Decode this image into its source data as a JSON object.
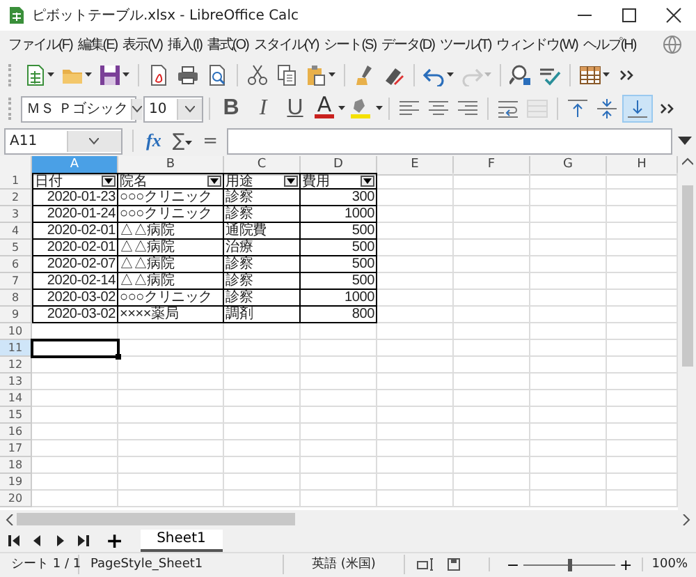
{
  "window": {
    "title": "ピボットテーブル.xlsx - LibreOffice Calc"
  },
  "menu": [
    "ファイル(F)",
    "編集(E)",
    "表示(V)",
    "挿入(I)",
    "書式(O)",
    "スタイル(Y)",
    "シート(S)",
    "データ(D)",
    "ツール(T)",
    "ウィンドウ(W)",
    "ヘルプ(H)"
  ],
  "standard_toolbar": [
    {
      "kind": "new",
      "dropdown": true,
      "disabled": false
    },
    {
      "kind": "open",
      "dropdown": true,
      "disabled": false
    },
    {
      "kind": "save",
      "dropdown": true,
      "disabled": false
    },
    {
      "kind": "separator"
    },
    {
      "kind": "pdf",
      "dropdown": false,
      "disabled": false
    },
    {
      "kind": "print",
      "dropdown": false,
      "disabled": false
    },
    {
      "kind": "preview",
      "dropdown": false,
      "disabled": false
    },
    {
      "kind": "separator"
    },
    {
      "kind": "cut",
      "dropdown": false,
      "disabled": false
    },
    {
      "kind": "copy",
      "dropdown": false,
      "disabled": false
    },
    {
      "kind": "paste",
      "dropdown": true,
      "disabled": false
    },
    {
      "kind": "separator"
    },
    {
      "kind": "brush",
      "dropdown": false,
      "disabled": false
    },
    {
      "kind": "clear",
      "dropdown": false,
      "disabled": false
    },
    {
      "kind": "separator"
    },
    {
      "kind": "undo",
      "dropdown": true,
      "disabled": false
    },
    {
      "kind": "redo",
      "dropdown": true,
      "disabled": true
    },
    {
      "kind": "separator"
    },
    {
      "kind": "find",
      "dropdown": false,
      "disabled": false
    },
    {
      "kind": "spell",
      "dropdown": false,
      "disabled": false
    },
    {
      "kind": "separator"
    },
    {
      "kind": "rows",
      "dropdown": true,
      "disabled": false
    },
    {
      "kind": "more",
      "dropdown": false,
      "disabled": false
    }
  ],
  "format_toolbar": {
    "font_name": "ＭＳ Ｐゴシック",
    "font_size": "10",
    "buttons": [
      {
        "kind": "bold",
        "label": "B",
        "selected": false,
        "disabled": false
      },
      {
        "kind": "italic",
        "label": "I",
        "selected": false,
        "disabled": false
      },
      {
        "kind": "underline",
        "label": "U",
        "selected": false,
        "disabled": false
      },
      {
        "kind": "font-color",
        "label": "A",
        "selected": false,
        "disabled": false
      },
      {
        "kind": "highlight",
        "selected": false,
        "disabled": false
      },
      {
        "kind": "separator"
      },
      {
        "kind": "align-left",
        "selected": false,
        "disabled": false
      },
      {
        "kind": "align-center",
        "selected": false,
        "disabled": false
      },
      {
        "kind": "align-right",
        "selected": false,
        "disabled": false
      },
      {
        "kind": "separator"
      },
      {
        "kind": "wrap",
        "selected": false,
        "disabled": false
      },
      {
        "kind": "merge",
        "selected": false,
        "disabled": true
      },
      {
        "kind": "separator"
      },
      {
        "kind": "valign-top",
        "selected": false,
        "disabled": false
      },
      {
        "kind": "valign-center",
        "selected": false,
        "disabled": false
      },
      {
        "kind": "valign-bottom",
        "selected": true,
        "disabled": false
      },
      {
        "kind": "more",
        "selected": false,
        "disabled": false
      }
    ]
  },
  "formula_bar": {
    "name_box": "A11",
    "function_wizard": "fx",
    "sum": "∑",
    "equals": "="
  },
  "columns": [
    {
      "letter": "A",
      "selected": true
    },
    {
      "letter": "B",
      "selected": false
    },
    {
      "letter": "C",
      "selected": false
    },
    {
      "letter": "D",
      "selected": false
    },
    {
      "letter": "E",
      "selected": false
    },
    {
      "letter": "F",
      "selected": false
    },
    {
      "letter": "G",
      "selected": false
    },
    {
      "letter": "H",
      "selected": false
    }
  ],
  "header_row": {
    "number": "1",
    "selected": false,
    "fields": [
      {
        "label": "日付",
        "kind": "number"
      },
      {
        "label": "院名",
        "kind": "text"
      },
      {
        "label": "用途",
        "kind": "text"
      },
      {
        "label": "費用",
        "kind": "number"
      }
    ]
  },
  "rows": [
    {
      "number": "2",
      "selected": false,
      "cells": [
        "2020-01-23",
        "○○○クリニック",
        "診察",
        "300"
      ]
    },
    {
      "number": "3",
      "selected": false,
      "cells": [
        "2020-01-24",
        "○○○クリニック",
        "診察",
        "1000"
      ]
    },
    {
      "number": "4",
      "selected": false,
      "cells": [
        "2020-02-01",
        "△△病院",
        "通院費",
        "500"
      ]
    },
    {
      "number": "5",
      "selected": false,
      "cells": [
        "2020-02-01",
        "△△病院",
        "治療",
        "500"
      ]
    },
    {
      "number": "6",
      "selected": false,
      "cells": [
        "2020-02-07",
        "△△病院",
        "診察",
        "500"
      ]
    },
    {
      "number": "7",
      "selected": false,
      "cells": [
        "2020-02-14",
        "△△病院",
        "診察",
        "500"
      ]
    },
    {
      "number": "8",
      "selected": false,
      "cells": [
        "2020-03-02",
        "○○○クリニック",
        "診察",
        "1000"
      ]
    },
    {
      "number": "9",
      "selected": false,
      "cells": [
        "2020-03-02",
        "××××薬局",
        "調剤",
        "800"
      ]
    },
    {
      "number": "10",
      "selected": false,
      "cells": []
    },
    {
      "number": "11",
      "selected": true,
      "cells": []
    },
    {
      "number": "12",
      "selected": false,
      "cells": []
    },
    {
      "number": "13",
      "selected": false,
      "cells": []
    },
    {
      "number": "14",
      "selected": false,
      "cells": []
    },
    {
      "number": "15",
      "selected": false,
      "cells": []
    },
    {
      "number": "16",
      "selected": false,
      "cells": []
    },
    {
      "number": "17",
      "selected": false,
      "cells": []
    },
    {
      "number": "18",
      "selected": false,
      "cells": []
    },
    {
      "number": "19",
      "selected": false,
      "cells": []
    },
    {
      "number": "20",
      "selected": false,
      "cells": []
    }
  ],
  "sheet_tabs": [
    {
      "label": "Sheet1",
      "selected": true
    }
  ],
  "add_sheet": "+",
  "status_bar": {
    "sheet": "シート 1 / 1",
    "page_style": "PageStyle_Sheet1",
    "language": "英語 (米国)",
    "zoom_out": "−",
    "zoom_in": "+",
    "zoom_level": {
      "level": 0.5
    },
    "zoom": "100%"
  }
}
